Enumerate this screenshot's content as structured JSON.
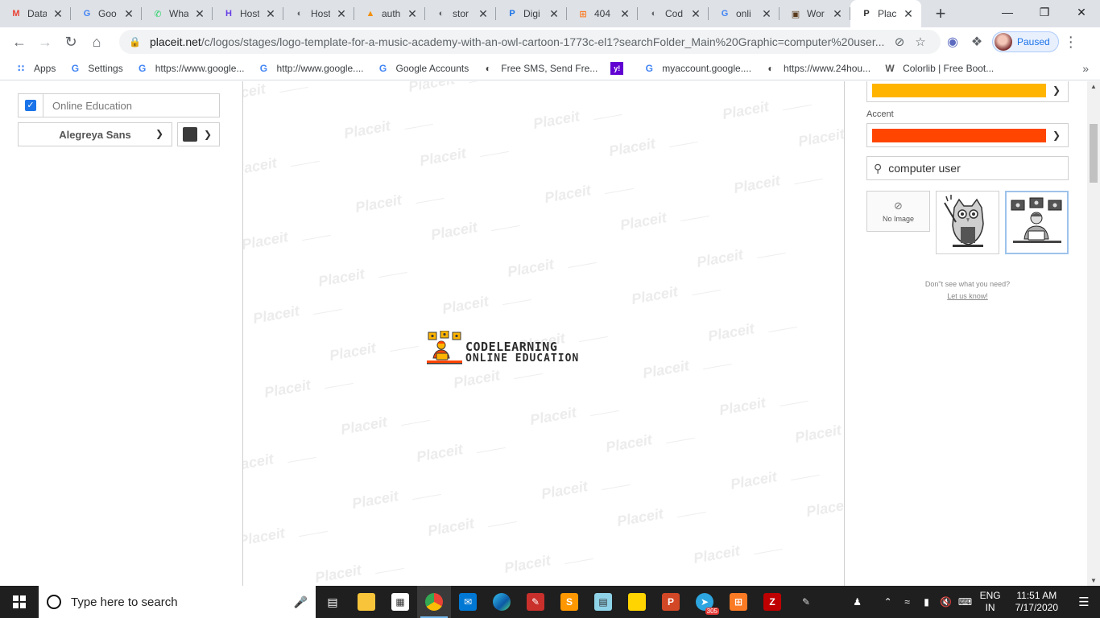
{
  "browser": {
    "tabs": [
      {
        "title": "Data",
        "icon": "gmail-icon",
        "color": "#ea4335"
      },
      {
        "title": "Goo",
        "icon": "google-icon",
        "color": "#4285f4"
      },
      {
        "title": "Wha",
        "icon": "whatsapp-icon",
        "color": "#25d366"
      },
      {
        "title": "Host",
        "icon": "hostinger-icon",
        "color": "#673de6"
      },
      {
        "title": "Host",
        "icon": "globe-icon",
        "color": "#5f6368"
      },
      {
        "title": "auth",
        "icon": "phpmyadmin-icon",
        "color": "#f29111"
      },
      {
        "title": "stor",
        "icon": "globe-icon",
        "color": "#5f6368"
      },
      {
        "title": "Digi",
        "icon": "pinterest-icon",
        "color": "#1a73e8"
      },
      {
        "title": "404",
        "icon": "xampp-icon",
        "color": "#fb7a24"
      },
      {
        "title": "Cod",
        "icon": "globe-icon",
        "color": "#5f6368"
      },
      {
        "title": "onli",
        "icon": "google-icon",
        "color": "#4285f4"
      },
      {
        "title": "Wor",
        "icon": "book-icon",
        "color": "#5a3b1e"
      },
      {
        "title": "Plac",
        "icon": "placeit-icon",
        "color": "#2d2d2d",
        "active": true
      }
    ],
    "url_host": "placeit.net",
    "url_path": "/c/logos/stages/logo-template-for-a-music-academy-with-an-owl-cartoon-1773c-el1?searchFolder_Main%20Graphic=computer%20user...",
    "profile_status": "Paused",
    "bookmarks": [
      {
        "label": "Apps",
        "icon": "apps-grid-icon"
      },
      {
        "label": "Settings",
        "icon": "google-icon"
      },
      {
        "label": "https://www.google...",
        "icon": "google-icon"
      },
      {
        "label": "http://www.google....",
        "icon": "google-icon"
      },
      {
        "label": "Google Accounts",
        "icon": "google-icon"
      },
      {
        "label": "Free SMS, Send Fre...",
        "icon": "globe-icon"
      },
      {
        "label": "",
        "icon": "yahoo-icon"
      },
      {
        "label": "myaccount.google....",
        "icon": "google-icon"
      },
      {
        "label": "https://www.24hou...",
        "icon": "globe-icon"
      },
      {
        "label": "Colorlib | Free Boot...",
        "icon": "wordpress-icon"
      }
    ]
  },
  "editor": {
    "text_field_value": "Online Education",
    "text_field_checked": true,
    "font_name": "Alegreya Sans",
    "text_color": "#3a3a3a",
    "primary_color": "#ffb400",
    "accent_label": "Accent",
    "accent_color": "#ff4500",
    "search_value": "computer user",
    "no_image_label": "No Image",
    "help_text": "Don\"t see what you need?",
    "help_link": "Let us know!",
    "watermark_text": "Placeit"
  },
  "logo": {
    "title": "CODELEARNING",
    "subtitle": "ONLINE EDUCATION"
  },
  "taskbar": {
    "search_placeholder": "Type here to search",
    "language": "ENG",
    "region": "IN",
    "time": "11:51 AM",
    "date": "7/17/2020",
    "badge_count": "305"
  }
}
